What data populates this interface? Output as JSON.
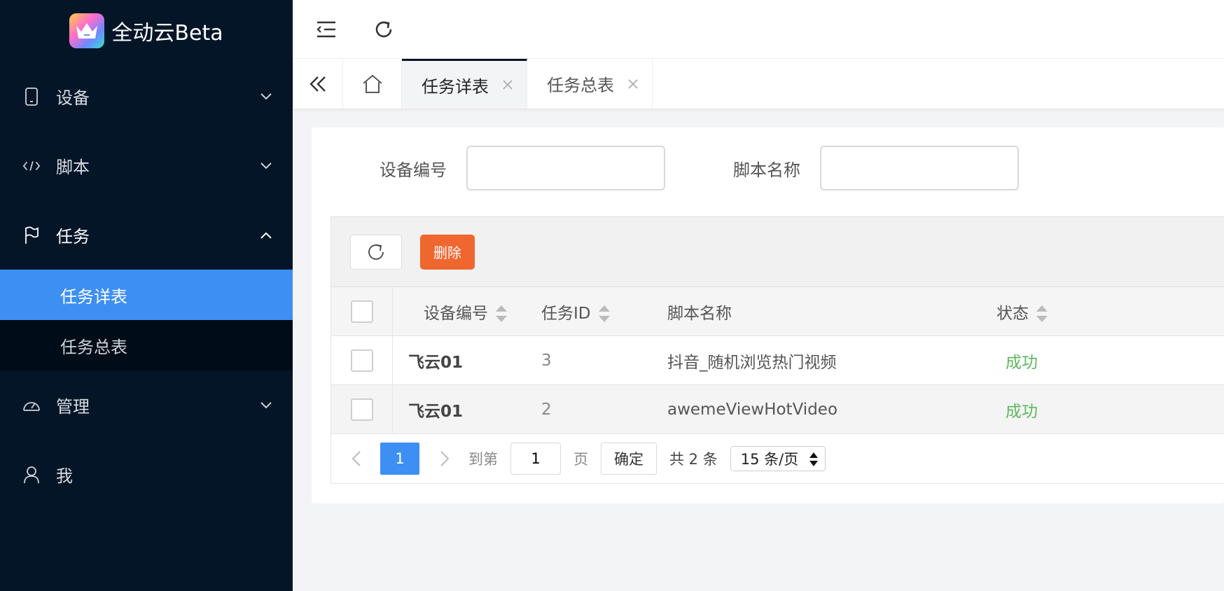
{
  "app": {
    "title": "全动云Beta",
    "accent": "#3d8ff4",
    "sidebar_bg": "#041528"
  },
  "sidebar": {
    "items": [
      {
        "label": "设备",
        "icon": "phone-icon"
      },
      {
        "label": "脚本",
        "icon": "code-icon"
      },
      {
        "label": "任务",
        "icon": "flag-icon",
        "open": true,
        "children": [
          {
            "label": "任务详表",
            "active": true
          },
          {
            "label": "任务总表"
          }
        ]
      },
      {
        "label": "管理",
        "icon": "dashboard-icon"
      },
      {
        "label": "我",
        "icon": "user-icon"
      }
    ]
  },
  "tabs": [
    {
      "label": "任务详表",
      "active": true
    },
    {
      "label": "任务总表"
    }
  ],
  "filters": {
    "device_label": "设备编号",
    "device_value": "",
    "script_label": "脚本名称",
    "script_value": ""
  },
  "toolbar": {
    "delete_label": "删除",
    "delete_color": "#f0662f"
  },
  "table": {
    "columns": [
      "设备编号",
      "任务ID",
      "脚本名称",
      "状态"
    ],
    "rows": [
      {
        "device": "飞云01",
        "task_id": "3",
        "script": "抖音_随机浏览热门视频",
        "status": "成功"
      },
      {
        "device": "飞云01",
        "task_id": "2",
        "script": "awemeViewHotVideo",
        "status": "成功"
      }
    ]
  },
  "pager": {
    "current": "1",
    "goto_label": "到第",
    "goto_value": "1",
    "page_label": "页",
    "confirm_label": "确定",
    "total": "共 2 条",
    "page_size": "15 条/页"
  }
}
